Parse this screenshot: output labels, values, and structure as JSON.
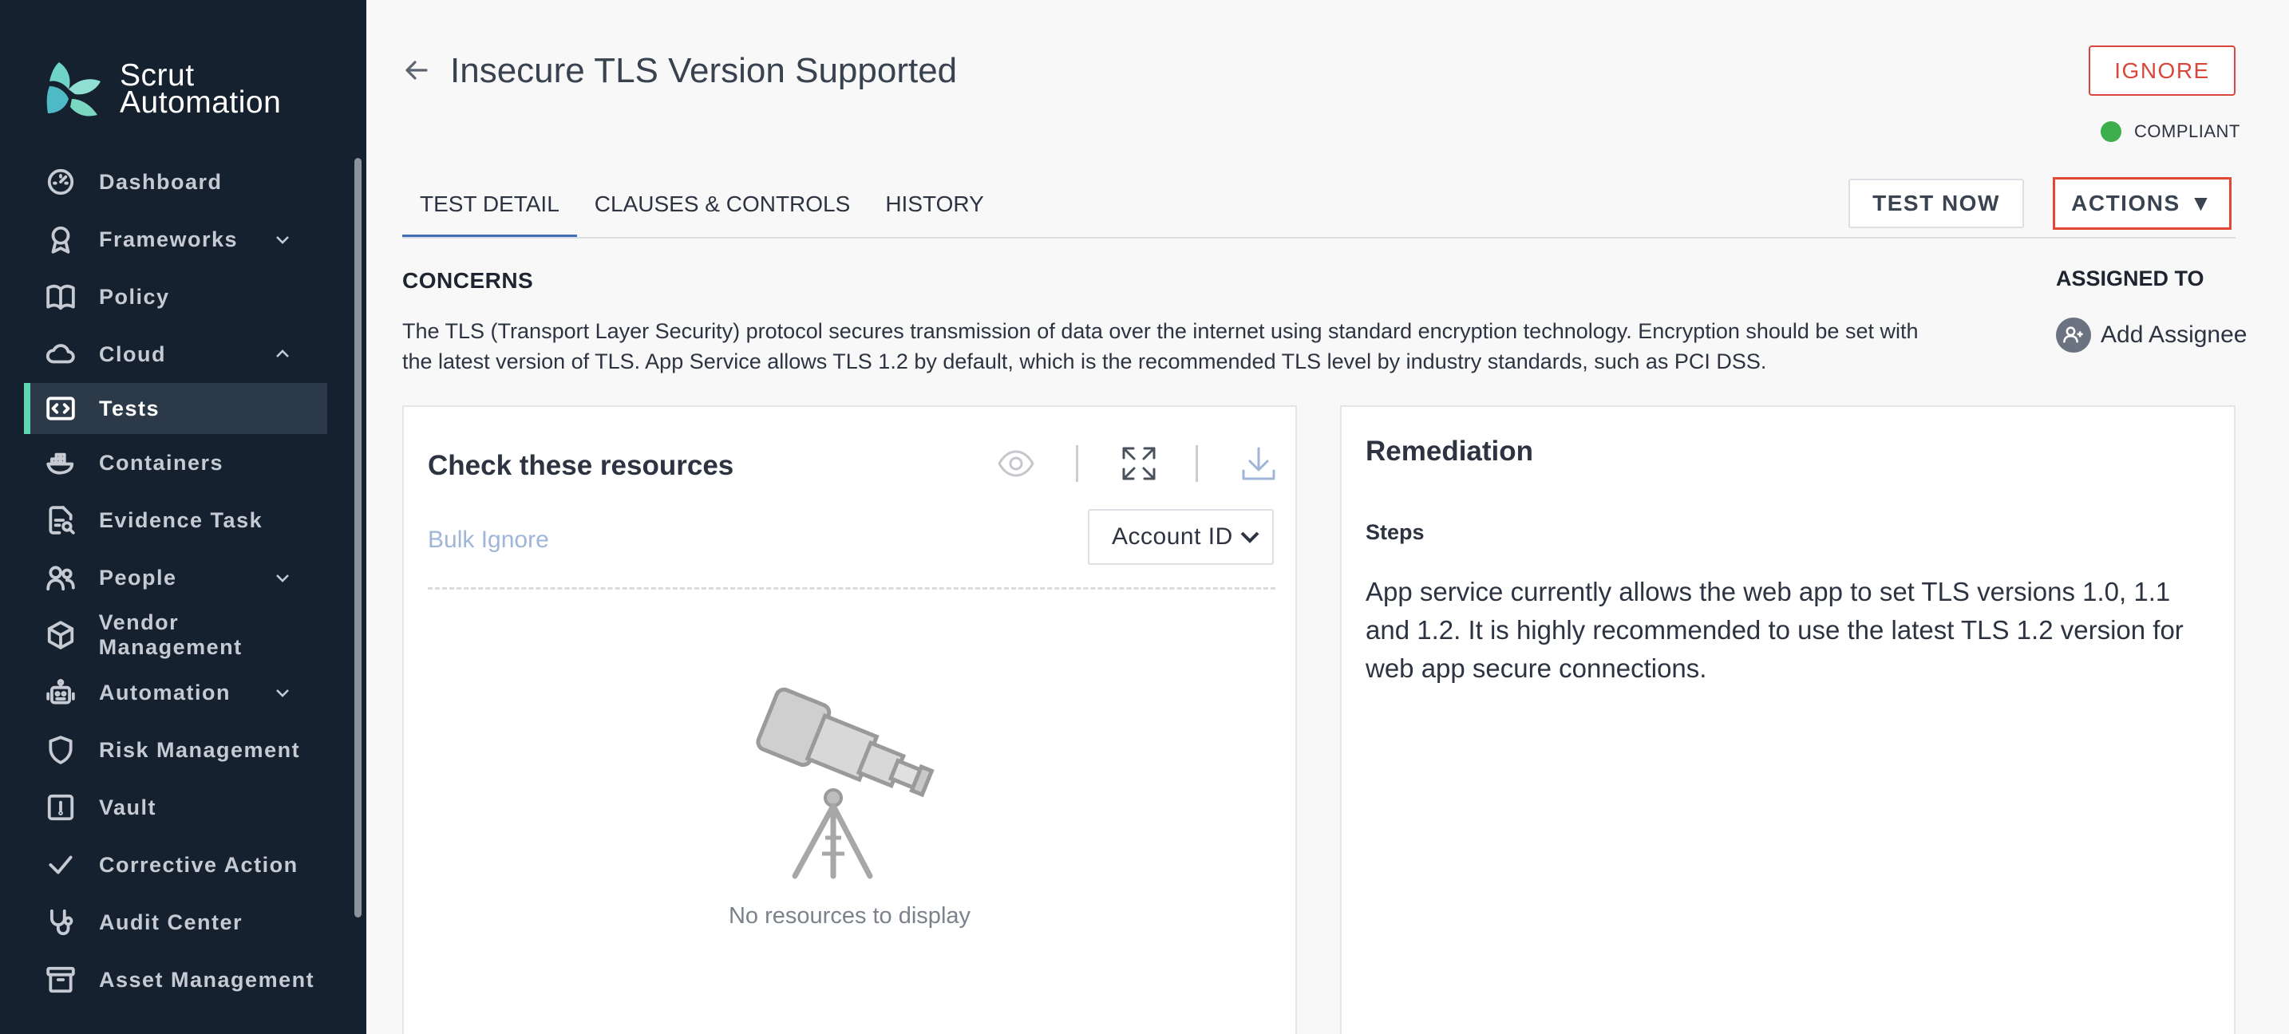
{
  "brand": {
    "name_line1": "Scrut",
    "name_line2": "Automation"
  },
  "sidebar": {
    "items": [
      {
        "label": "Dashboard",
        "icon": "dashboard-icon",
        "chevron": ""
      },
      {
        "label": "Frameworks",
        "icon": "frameworks-icon",
        "chevron": "down"
      },
      {
        "label": "Policy",
        "icon": "policy-icon",
        "chevron": ""
      },
      {
        "label": "Cloud",
        "icon": "cloud-icon",
        "chevron": "up"
      },
      {
        "label": "Tests",
        "icon": "code-icon",
        "chevron": "",
        "active": true
      },
      {
        "label": "Containers",
        "icon": "docker-icon",
        "chevron": ""
      },
      {
        "label": "Evidence Task",
        "icon": "evidence-icon",
        "chevron": ""
      },
      {
        "label": "People",
        "icon": "people-icon",
        "chevron": "down"
      },
      {
        "label": "Vendor Management",
        "icon": "vendor-icon",
        "chevron": ""
      },
      {
        "label": "Automation",
        "icon": "robot-icon",
        "chevron": "down"
      },
      {
        "label": "Risk Management",
        "icon": "shield-icon",
        "chevron": ""
      },
      {
        "label": "Vault",
        "icon": "vault-icon",
        "chevron": ""
      },
      {
        "label": "Corrective Action",
        "icon": "check-icon",
        "chevron": ""
      },
      {
        "label": "Audit Center",
        "icon": "stethoscope-icon",
        "chevron": ""
      },
      {
        "label": "Asset Management",
        "icon": "archive-icon",
        "chevron": ""
      }
    ]
  },
  "header": {
    "title": "Insecure TLS Version Supported",
    "ignore_label": "IGNORE",
    "status_label": "COMPLIANT",
    "status_color": "#3cae4c"
  },
  "tabs": [
    {
      "label": "TEST DETAIL",
      "active": true
    },
    {
      "label": "CLAUSES & CONTROLS",
      "active": false
    },
    {
      "label": "HISTORY",
      "active": false
    }
  ],
  "toolbar": {
    "test_now_label": "TEST NOW",
    "actions_label": "ACTIONS"
  },
  "concerns": {
    "heading": "CONCERNS",
    "text": "The TLS (Transport Layer Security) protocol secures transmission of data over the internet using standard encryption technology. Encryption should be set with the latest version of TLS. App Service allows TLS 1.2 by default, which is the recommended TLS level by industry standards, such as PCI DSS."
  },
  "assigned": {
    "heading": "ASSIGNED TO",
    "add_label": "Add Assignee"
  },
  "resources": {
    "title": "Check these resources",
    "bulk_ignore_label": "Bulk Ignore",
    "account_select_value": "Account ID",
    "empty_text": "No resources to display"
  },
  "remediation": {
    "title": "Remediation",
    "steps_heading": "Steps",
    "steps_text": "App service currently allows the web app to set TLS versions 1.0, 1.1 and 1.2. It is highly recommended to use the latest TLS 1.2 version for web app secure connections."
  }
}
